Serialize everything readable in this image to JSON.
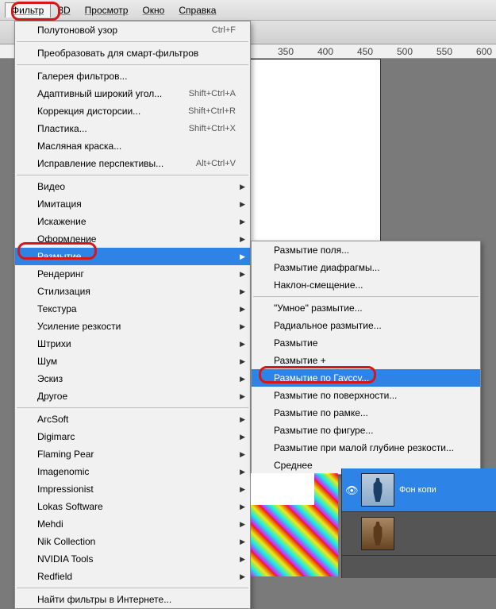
{
  "menubar": {
    "filter": "Фильтр",
    "threeD": "3D",
    "view": "Просмотр",
    "window": "Окно",
    "help": "Справка"
  },
  "ruler": {
    "m350": "350",
    "m400": "400",
    "m450": "450",
    "m500": "500",
    "m550": "550",
    "m600": "600"
  },
  "menu": {
    "last": {
      "label": "Полутоновой узор",
      "shortcut": "Ctrl+F"
    },
    "smart": "Преобразовать для смарт-фильтров",
    "gallery": "Галерея фильтров...",
    "adaptive": {
      "label": "Адаптивный широкий угол...",
      "shortcut": "Shift+Ctrl+A"
    },
    "lens": {
      "label": "Коррекция дисторсии...",
      "shortcut": "Shift+Ctrl+R"
    },
    "liquify": {
      "label": "Пластика...",
      "shortcut": "Shift+Ctrl+X"
    },
    "oil": "Масляная краска...",
    "vanish": {
      "label": "Исправление перспективы...",
      "shortcut": "Alt+Ctrl+V"
    },
    "video": "Видео",
    "imitation": "Имитация",
    "distort": "Искажение",
    "stylizeTop": "Оформление",
    "blur": "Размытие",
    "render": "Рендеринг",
    "stylize": "Стилизация",
    "texture": "Текстура",
    "sharpen": "Усиление резкости",
    "strokes": "Штрихи",
    "noise": "Шум",
    "sketch": "Эскиз",
    "other": "Другое",
    "arcsoft": "ArcSoft",
    "digimarc": "Digimarc",
    "flaming": "Flaming Pear",
    "imagenomic": "Imagenomic",
    "impressionist": "Impressionist",
    "lokas": "Lokas Software",
    "mehdi": "Mehdi",
    "nik": "Nik Collection",
    "nvidia": "NVIDIA Tools",
    "redfield": "Redfield",
    "browse": "Найти фильтры в Интернете..."
  },
  "submenu": {
    "field": "Размытие поля...",
    "iris": "Размытие диафрагмы...",
    "tilt": "Наклон-смещение...",
    "smart": "\"Умное\" размытие...",
    "radial": "Радиальное размытие...",
    "blur": "Размытие",
    "more": "Размытие +",
    "gauss": "Размытие по Гауссу...",
    "surface": "Размытие по поверхности...",
    "box": "Размытие по рамке...",
    "shape": "Размытие по фигуре...",
    "lowdof": "Размытие при малой глубине резкости...",
    "average": "Среднее"
  },
  "layers": {
    "l1": "Фон копи",
    "l2": ""
  }
}
